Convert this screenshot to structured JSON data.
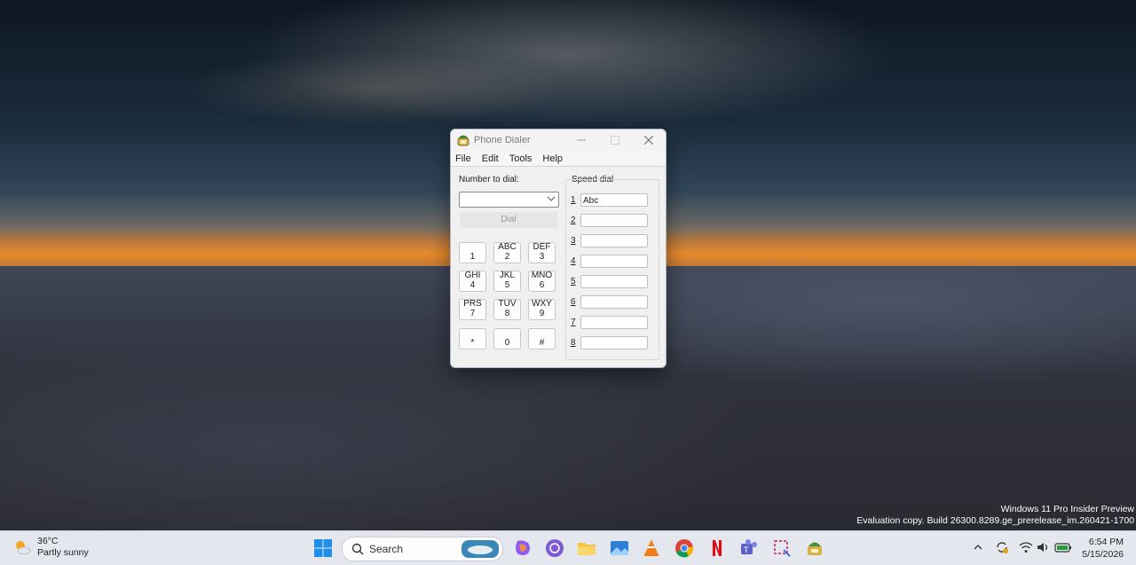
{
  "desktop": {
    "watermark_line1": "Windows 11 Pro Insider Preview",
    "watermark_line2": "Evaluation copy. Build 26300.8289.ge_prerelease_im.260421-1700"
  },
  "window": {
    "title": "Phone Dialer",
    "menu": [
      "File",
      "Edit",
      "Tools",
      "Help"
    ],
    "number_label": "Number to dial:",
    "number_value": "",
    "dial_button": "Dial",
    "keypad": [
      {
        "letters": "",
        "digit": "1"
      },
      {
        "letters": "ABC",
        "digit": "2"
      },
      {
        "letters": "DEF",
        "digit": "3"
      },
      {
        "letters": "GHI",
        "digit": "4"
      },
      {
        "letters": "JKL",
        "digit": "5"
      },
      {
        "letters": "MNO",
        "digit": "6"
      },
      {
        "letters": "PRS",
        "digit": "7"
      },
      {
        "letters": "TUV",
        "digit": "8"
      },
      {
        "letters": "WXY",
        "digit": "9"
      },
      {
        "letters": "",
        "digit": "*"
      },
      {
        "letters": "",
        "digit": "0"
      },
      {
        "letters": "",
        "digit": "#"
      }
    ],
    "speed_dial_label": "Speed dial",
    "speed_dial": [
      {
        "num": "1",
        "value": "Abc"
      },
      {
        "num": "2",
        "value": ""
      },
      {
        "num": "3",
        "value": ""
      },
      {
        "num": "4",
        "value": ""
      },
      {
        "num": "5",
        "value": ""
      },
      {
        "num": "6",
        "value": ""
      },
      {
        "num": "7",
        "value": ""
      },
      {
        "num": "8",
        "value": ""
      }
    ]
  },
  "taskbar": {
    "weather_temp": "36°C",
    "weather_desc": "Partly sunny",
    "search_label": "Search",
    "time": "6:54 PM",
    "date": "5/15/2026"
  }
}
